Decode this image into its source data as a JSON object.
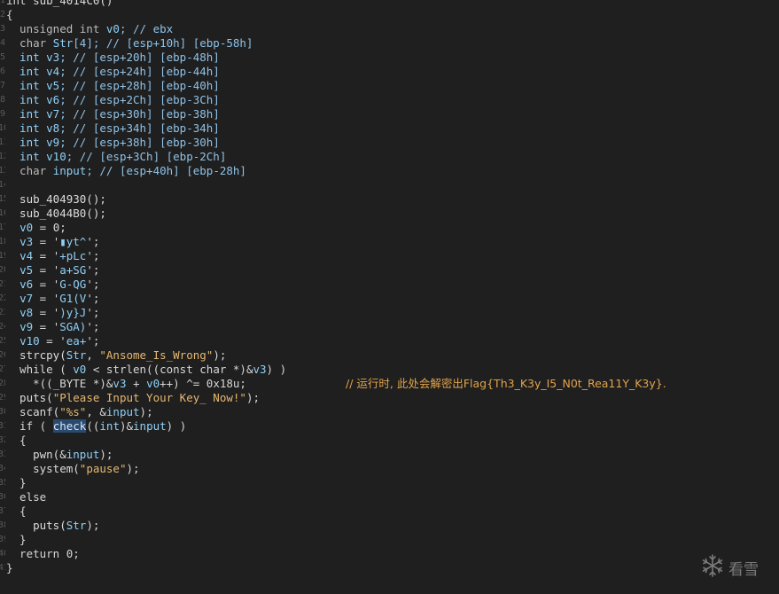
{
  "lines": [
    {
      "n": "1",
      "tokens": [
        {
          "t": "int ",
          "c": "t-kw"
        },
        {
          "t": "sub_4014C0()",
          "c": "t-fn"
        }
      ]
    },
    {
      "n": "2",
      "tokens": [
        {
          "t": "{",
          "c": "t-pl"
        }
      ]
    },
    {
      "n": "3",
      "tokens": [
        {
          "t": "  unsigned int ",
          "c": "t-ty"
        },
        {
          "t": "v0",
          "c": "t-var"
        },
        {
          "t": "; // ebx",
          "c": "t-c"
        }
      ]
    },
    {
      "n": "4",
      "tokens": [
        {
          "t": "  char ",
          "c": "t-ty"
        },
        {
          "t": "Str",
          "c": "t-var"
        },
        {
          "t": "[4]; // [esp+10h] [ebp-58h]",
          "c": "t-c"
        }
      ]
    },
    {
      "n": "5",
      "tokens": [
        {
          "t": "  int ",
          "c": "t-kw2"
        },
        {
          "t": "v3",
          "c": "t-var"
        },
        {
          "t": "; // [esp+20h] [ebp-48h]",
          "c": "t-c"
        }
      ]
    },
    {
      "n": "6",
      "tokens": [
        {
          "t": "  int ",
          "c": "t-kw2"
        },
        {
          "t": "v4",
          "c": "t-var"
        },
        {
          "t": "; // [esp+24h] [ebp-44h]",
          "c": "t-c"
        }
      ]
    },
    {
      "n": "7",
      "tokens": [
        {
          "t": "  int ",
          "c": "t-kw2"
        },
        {
          "t": "v5",
          "c": "t-var"
        },
        {
          "t": "; // [esp+28h] [ebp-40h]",
          "c": "t-c"
        }
      ]
    },
    {
      "n": "8",
      "tokens": [
        {
          "t": "  int ",
          "c": "t-kw2"
        },
        {
          "t": "v6",
          "c": "t-var"
        },
        {
          "t": "; // [esp+2Ch] [ebp-3Ch]",
          "c": "t-c"
        }
      ]
    },
    {
      "n": "9",
      "tokens": [
        {
          "t": "  int ",
          "c": "t-kw2"
        },
        {
          "t": "v7",
          "c": "t-var"
        },
        {
          "t": "; // [esp+30h] [ebp-38h]",
          "c": "t-c"
        }
      ]
    },
    {
      "n": "10",
      "tokens": [
        {
          "t": "  int ",
          "c": "t-kw2"
        },
        {
          "t": "v8",
          "c": "t-var"
        },
        {
          "t": "; // [esp+34h] [ebp-34h]",
          "c": "t-c"
        }
      ]
    },
    {
      "n": "11",
      "tokens": [
        {
          "t": "  int ",
          "c": "t-kw2"
        },
        {
          "t": "v9",
          "c": "t-var"
        },
        {
          "t": "; // [esp+38h] [ebp-30h]",
          "c": "t-c"
        }
      ]
    },
    {
      "n": "12",
      "tokens": [
        {
          "t": "  int ",
          "c": "t-kw2"
        },
        {
          "t": "v10",
          "c": "t-var"
        },
        {
          "t": "; // [esp+3Ch] [ebp-2Ch]",
          "c": "t-c"
        }
      ]
    },
    {
      "n": "13",
      "tokens": [
        {
          "t": "  char ",
          "c": "t-ty"
        },
        {
          "t": "input",
          "c": "t-var"
        },
        {
          "t": "; // [esp+40h] [ebp-28h]",
          "c": "t-c"
        }
      ]
    },
    {
      "n": "14",
      "tokens": []
    },
    {
      "n": "15",
      "tokens": [
        {
          "t": "  sub_404930();",
          "c": "t-fn"
        }
      ]
    },
    {
      "n": "16",
      "tokens": [
        {
          "t": "  sub_4044B0();",
          "c": "t-fn"
        }
      ]
    },
    {
      "n": "17",
      "tokens": [
        {
          "t": "  ",
          "c": "t-pl"
        },
        {
          "t": "v0",
          "c": "t-var"
        },
        {
          "t": " = 0;",
          "c": "t-pl"
        }
      ]
    },
    {
      "n": "18",
      "tokens": [
        {
          "t": "  ",
          "c": "t-pl"
        },
        {
          "t": "v3",
          "c": "t-var"
        },
        {
          "t": " = '",
          "c": "t-pl"
        },
        {
          "t": "▮yt^",
          "c": "t-str"
        },
        {
          "t": "';",
          "c": "t-pl"
        }
      ]
    },
    {
      "n": "19",
      "tokens": [
        {
          "t": "  ",
          "c": "t-pl"
        },
        {
          "t": "v4",
          "c": "t-var"
        },
        {
          "t": " = '",
          "c": "t-pl"
        },
        {
          "t": "+pLc",
          "c": "t-str"
        },
        {
          "t": "';",
          "c": "t-pl"
        }
      ]
    },
    {
      "n": "20",
      "tokens": [
        {
          "t": "  ",
          "c": "t-pl"
        },
        {
          "t": "v5",
          "c": "t-var"
        },
        {
          "t": " = '",
          "c": "t-pl"
        },
        {
          "t": "a+SG",
          "c": "t-str"
        },
        {
          "t": "';",
          "c": "t-pl"
        }
      ]
    },
    {
      "n": "21",
      "tokens": [
        {
          "t": "  ",
          "c": "t-pl"
        },
        {
          "t": "v6",
          "c": "t-var"
        },
        {
          "t": " = '",
          "c": "t-pl"
        },
        {
          "t": "G-QG",
          "c": "t-str"
        },
        {
          "t": "';",
          "c": "t-pl"
        }
      ]
    },
    {
      "n": "22",
      "tokens": [
        {
          "t": "  ",
          "c": "t-pl"
        },
        {
          "t": "v7",
          "c": "t-var"
        },
        {
          "t": " = '",
          "c": "t-pl"
        },
        {
          "t": "G1(V",
          "c": "t-str"
        },
        {
          "t": "';",
          "c": "t-pl"
        }
      ]
    },
    {
      "n": "23",
      "tokens": [
        {
          "t": "  ",
          "c": "t-pl"
        },
        {
          "t": "v8",
          "c": "t-var"
        },
        {
          "t": " = '",
          "c": "t-pl"
        },
        {
          "t": ")y}J",
          "c": "t-str"
        },
        {
          "t": "';",
          "c": "t-pl"
        }
      ]
    },
    {
      "n": "24",
      "tokens": [
        {
          "t": "  ",
          "c": "t-pl"
        },
        {
          "t": "v9",
          "c": "t-var"
        },
        {
          "t": " = '",
          "c": "t-pl"
        },
        {
          "t": "SGA)",
          "c": "t-str"
        },
        {
          "t": "';",
          "c": "t-pl"
        }
      ]
    },
    {
      "n": "25",
      "tokens": [
        {
          "t": "  ",
          "c": "t-pl"
        },
        {
          "t": "v10",
          "c": "t-var"
        },
        {
          "t": " = '",
          "c": "t-pl"
        },
        {
          "t": "ea+",
          "c": "t-str"
        },
        {
          "t": "';",
          "c": "t-pl"
        }
      ]
    },
    {
      "n": "26",
      "tokens": [
        {
          "t": "  strcpy(",
          "c": "t-fn"
        },
        {
          "t": "Str",
          "c": "t-var"
        },
        {
          "t": ", ",
          "c": "t-pl"
        },
        {
          "t": "\"Ansome_Is_Wrong\"",
          "c": "t-cstr"
        },
        {
          "t": ");",
          "c": "t-pl"
        }
      ]
    },
    {
      "n": "27",
      "tokens": [
        {
          "t": "  while ( ",
          "c": "t-kw"
        },
        {
          "t": "v0",
          "c": "t-var"
        },
        {
          "t": " < strlen((const char *)&",
          "c": "t-pl"
        },
        {
          "t": "v3",
          "c": "t-var"
        },
        {
          "t": ") )",
          "c": "t-pl"
        }
      ]
    },
    {
      "n": "28",
      "tokens": [
        {
          "t": "    *((_BYTE *)&",
          "c": "t-pl"
        },
        {
          "t": "v3",
          "c": "t-var"
        },
        {
          "t": " + ",
          "c": "t-pl"
        },
        {
          "t": "v0",
          "c": "t-var"
        },
        {
          "t": "++) ^= 0x18u;",
          "c": "t-pl"
        }
      ],
      "comment": "// 运行时, 此处会解密出Flag{Th3_K3y_I5_N0t_Rea11Y_K3y}."
    },
    {
      "n": "29",
      "tokens": [
        {
          "t": "  puts(",
          "c": "t-fn"
        },
        {
          "t": "\"Please Input Your Key_ Now!\"",
          "c": "t-cstr"
        },
        {
          "t": ");",
          "c": "t-pl"
        }
      ]
    },
    {
      "n": "30",
      "tokens": [
        {
          "t": "  scanf(",
          "c": "t-fn"
        },
        {
          "t": "\"%s\"",
          "c": "t-cstr"
        },
        {
          "t": ", &",
          "c": "t-pl"
        },
        {
          "t": "input",
          "c": "t-var"
        },
        {
          "t": ");",
          "c": "t-pl"
        }
      ]
    },
    {
      "n": "31",
      "tokens": [
        {
          "t": "  if ( ",
          "c": "t-kw"
        },
        {
          "t": "check",
          "c": "t-hl"
        },
        {
          "t": "((",
          "c": "t-pl"
        },
        {
          "t": "int",
          "c": "t-kw2"
        },
        {
          "t": ")&",
          "c": "t-pl"
        },
        {
          "t": "input",
          "c": "t-var"
        },
        {
          "t": ") )",
          "c": "t-pl"
        }
      ]
    },
    {
      "n": "32",
      "tokens": [
        {
          "t": "  {",
          "c": "t-pl"
        }
      ]
    },
    {
      "n": "33",
      "tokens": [
        {
          "t": "    pwn(&",
          "c": "t-fn"
        },
        {
          "t": "input",
          "c": "t-var"
        },
        {
          "t": ");",
          "c": "t-pl"
        }
      ]
    },
    {
      "n": "34",
      "tokens": [
        {
          "t": "    system(",
          "c": "t-fn"
        },
        {
          "t": "\"pause\"",
          "c": "t-cstr"
        },
        {
          "t": ");",
          "c": "t-pl"
        }
      ]
    },
    {
      "n": "35",
      "tokens": [
        {
          "t": "  }",
          "c": "t-pl"
        }
      ]
    },
    {
      "n": "36",
      "tokens": [
        {
          "t": "  else",
          "c": "t-kw"
        }
      ]
    },
    {
      "n": "37",
      "tokens": [
        {
          "t": "  {",
          "c": "t-pl"
        }
      ]
    },
    {
      "n": "38",
      "tokens": [
        {
          "t": "    puts(",
          "c": "t-fn"
        },
        {
          "t": "Str",
          "c": "t-var"
        },
        {
          "t": ");",
          "c": "t-pl"
        }
      ]
    },
    {
      "n": "39",
      "tokens": [
        {
          "t": "  }",
          "c": "t-pl"
        }
      ]
    },
    {
      "n": "40",
      "tokens": [
        {
          "t": "  return 0;",
          "c": "t-kw"
        }
      ]
    },
    {
      "n": "41",
      "tokens": [
        {
          "t": "}",
          "c": "t-pl"
        }
      ]
    }
  ],
  "watermark": {
    "text": "看雪",
    "icon": "snowflake-icon"
  },
  "colors": {
    "background": "#1f1f1f",
    "variable": "#8fd0f7",
    "string": "#e6b870",
    "comment": "#e0a34c",
    "highlight": "#2a4a6e"
  }
}
